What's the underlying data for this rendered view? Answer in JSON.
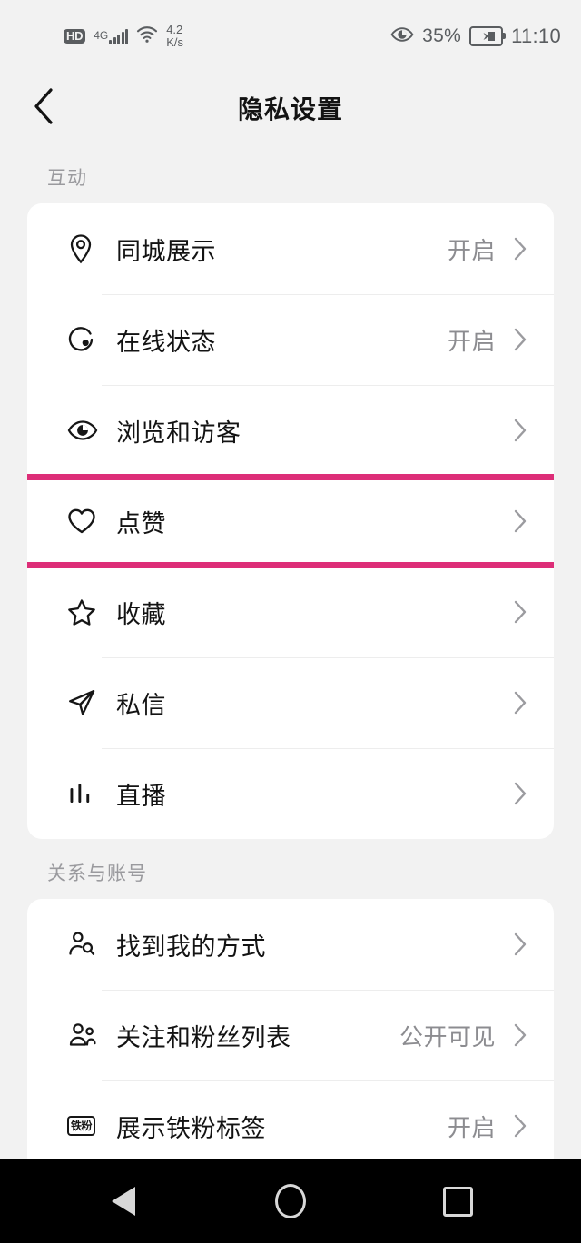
{
  "status_bar": {
    "hd_label": "HD",
    "network_label": "4G",
    "signal_icon": "signal-bars-icon",
    "wifi_icon": "wifi-icon",
    "data_speed": "4.2",
    "data_speed_unit": "K/s",
    "eye_icon": "eye-care-icon",
    "battery_percent": "35%",
    "battery_icon": "battery-charging-icon",
    "time": "11:10"
  },
  "header": {
    "back_icon": "back-chevron-icon",
    "title": "隐私设置"
  },
  "sections": [
    {
      "label": "互动",
      "rows": [
        {
          "icon": "location-pin-icon",
          "label": "同城展示",
          "value": "开启",
          "highlighted": false
        },
        {
          "icon": "online-status-icon",
          "label": "在线状态",
          "value": "开启",
          "highlighted": false
        },
        {
          "icon": "eye-icon",
          "label": "浏览和访客",
          "value": "",
          "highlighted": false
        },
        {
          "icon": "heart-icon",
          "label": "点赞",
          "value": "",
          "highlighted": true
        },
        {
          "icon": "star-icon",
          "label": "收藏",
          "value": "",
          "highlighted": false
        },
        {
          "icon": "paper-plane-icon",
          "label": "私信",
          "value": "",
          "highlighted": false
        },
        {
          "icon": "live-bars-icon",
          "label": "直播",
          "value": "",
          "highlighted": false
        }
      ]
    },
    {
      "label": "关系与账号",
      "rows": [
        {
          "icon": "person-search-icon",
          "label": "找到我的方式",
          "value": "",
          "highlighted": false
        },
        {
          "icon": "people-group-icon",
          "label": "关注和粉丝列表",
          "value": "公开可见",
          "highlighted": false
        },
        {
          "icon": "tiefen-badge-icon",
          "icon_text": "铁粉",
          "label": "展示铁粉标签",
          "value": "开启",
          "highlighted": false
        }
      ]
    }
  ],
  "nav_bar": {
    "back_icon": "nav-back-triangle-icon",
    "home_icon": "nav-home-circle-icon",
    "recents_icon": "nav-recents-square-icon"
  },
  "colors": {
    "highlight": "#dd2e78",
    "background": "#f2f2f2",
    "card": "#ffffff",
    "primary_text": "#131313",
    "secondary_text": "#8c8c90",
    "section_label": "#9a9a9e"
  }
}
